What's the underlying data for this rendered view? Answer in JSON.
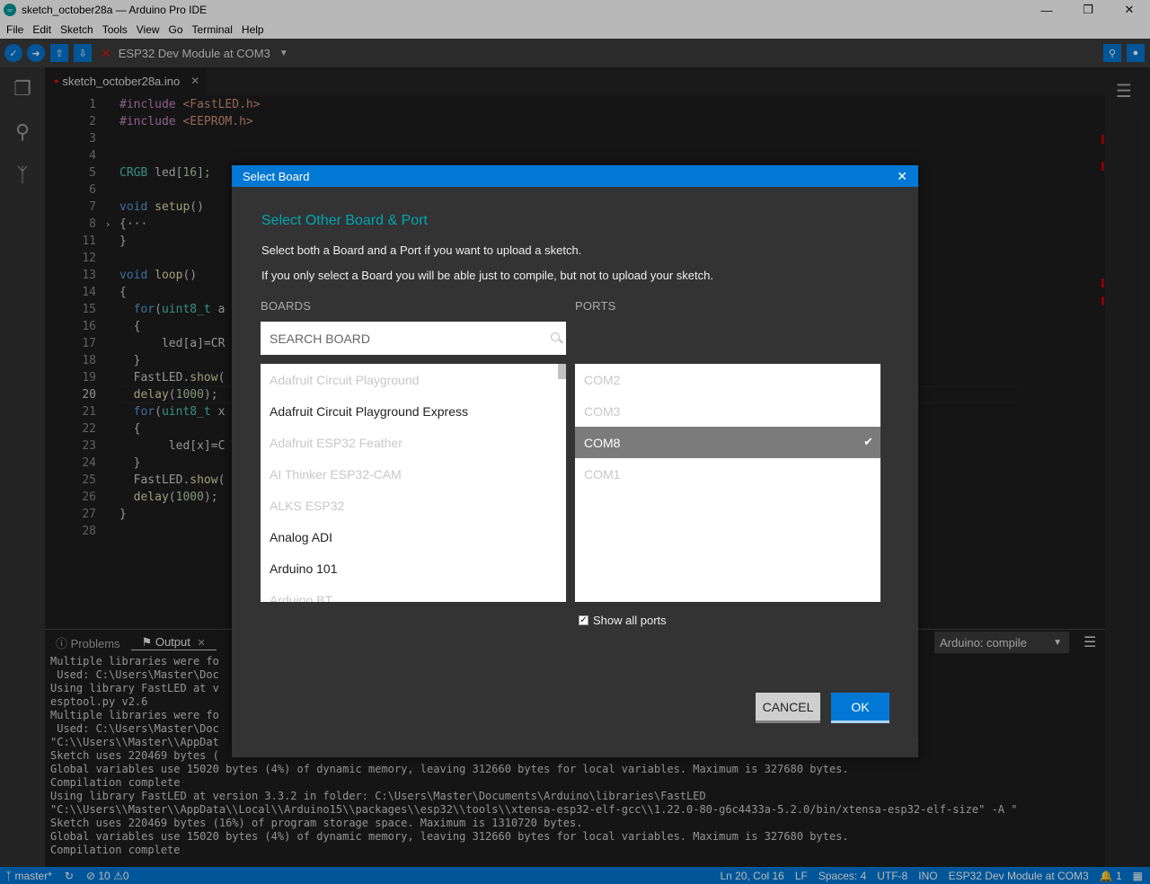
{
  "window": {
    "title": "sketch_october28a — Arduino Pro IDE"
  },
  "menu": [
    "File",
    "Edit",
    "Sketch",
    "Tools",
    "View",
    "Go",
    "Terminal",
    "Help"
  ],
  "toolbar": {
    "board_label": "ESP32 Dev Module at COM3"
  },
  "tab": {
    "filename": "sketch_october28a.ino"
  },
  "editor": {
    "lines": [
      {
        "n": "1",
        "code": "#include <FastLED.h>"
      },
      {
        "n": "2",
        "code": "#include <EEPROM.h>"
      },
      {
        "n": "3",
        "code": ""
      },
      {
        "n": "4",
        "code": ""
      },
      {
        "n": "5",
        "code": "CRGB led[16];"
      },
      {
        "n": "6",
        "code": ""
      },
      {
        "n": "7",
        "code": "void setup()"
      },
      {
        "n": "8",
        "code": "{···"
      },
      {
        "n": "11",
        "code": "}"
      },
      {
        "n": "12",
        "code": ""
      },
      {
        "n": "13",
        "code": "void loop()"
      },
      {
        "n": "14",
        "code": "{"
      },
      {
        "n": "15",
        "code": "  for(uint8_t a"
      },
      {
        "n": "16",
        "code": "  {"
      },
      {
        "n": "17",
        "code": "      led[a]=CR"
      },
      {
        "n": "18",
        "code": "  }"
      },
      {
        "n": "19",
        "code": "  FastLED.show("
      },
      {
        "n": "20",
        "code": "  delay(1000);"
      },
      {
        "n": "21",
        "code": "  for(uint8_t x"
      },
      {
        "n": "22",
        "code": "  {"
      },
      {
        "n": "23",
        "code": "       led[x]=C"
      },
      {
        "n": "24",
        "code": "  }"
      },
      {
        "n": "25",
        "code": "  FastLED.show("
      },
      {
        "n": "26",
        "code": "  delay(1000);"
      },
      {
        "n": "27",
        "code": "}"
      },
      {
        "n": "28",
        "code": ""
      }
    ]
  },
  "panel": {
    "tab_problems": "Problems",
    "tab_output": "Output",
    "output_channel": "Arduino: compile",
    "output_lines": [
      "Multiple libraries were fo",
      " Used: C:\\Users\\Master\\Doc",
      "Using library FastLED at v",
      "esptool.py v2.6",
      "Multiple libraries were fo",
      " Used: C:\\Users\\Master\\Doc",
      "\"C:\\\\Users\\\\Master\\\\AppDat                                                                                  tensa-esp32-elf-size\" -A \"",
      "Sketch uses 220469 bytes (",
      "Global variables use 15020 bytes (4%) of dynamic memory, leaving 312660 bytes for local variables. Maximum is 327680 bytes.",
      "Compilation complete",
      "Using library FastLED at version 3.3.2 in folder: C:\\Users\\Master\\Documents\\Arduino\\libraries\\FastLED",
      "\"C:\\\\Users\\\\Master\\\\AppData\\\\Local\\\\Arduino15\\\\packages\\\\esp32\\\\tools\\\\xtensa-esp32-elf-gcc\\\\1.22.0-80-g6c4433a-5.2.0/bin/xtensa-esp32-elf-size\" -A \"",
      "Sketch uses 220469 bytes (16%) of program storage space. Maximum is 1310720 bytes.",
      "Global variables use 15020 bytes (4%) of dynamic memory, leaving 312660 bytes for local variables. Maximum is 327680 bytes.",
      "Compilation complete"
    ]
  },
  "status": {
    "branch": "master*",
    "errors": "10",
    "warnings": "0",
    "position": "Ln 20, Col 16",
    "eol": "LF",
    "spaces": "Spaces: 4",
    "encoding": "UTF-8",
    "language": "INO",
    "board": "ESP32 Dev Module at COM3",
    "notifications": "1"
  },
  "dialog": {
    "title": "Select Board",
    "heading": "Select Other Board & Port",
    "desc1": "Select both a Board and a Port if you want to upload a sketch.",
    "desc2": "If you only select a Board you will be able just to compile, but not to upload your sketch.",
    "boards_label": "BOARDS",
    "ports_label": "PORTS",
    "search_placeholder": "SEARCH BOARD",
    "boards": [
      {
        "name": "Adafruit Circuit Playground",
        "enabled": false
      },
      {
        "name": "Adafruit Circuit Playground Express",
        "enabled": true
      },
      {
        "name": "Adafruit ESP32 Feather",
        "enabled": false
      },
      {
        "name": "AI Thinker ESP32-CAM",
        "enabled": false
      },
      {
        "name": "ALKS ESP32",
        "enabled": false
      },
      {
        "name": "Analog ADI",
        "enabled": true
      },
      {
        "name": "Arduino 101",
        "enabled": true
      },
      {
        "name": "Arduino BT",
        "enabled": false
      }
    ],
    "ports": [
      {
        "name": "COM2",
        "selected": false
      },
      {
        "name": "COM3",
        "selected": false
      },
      {
        "name": "COM8",
        "selected": true
      },
      {
        "name": "COM1",
        "selected": false
      }
    ],
    "show_all_ports": "Show all ports",
    "cancel": "CANCEL",
    "ok": "OK"
  },
  "colors": {
    "accent": "#0078d4",
    "heading": "#00a6b1",
    "error": "#e51400"
  }
}
